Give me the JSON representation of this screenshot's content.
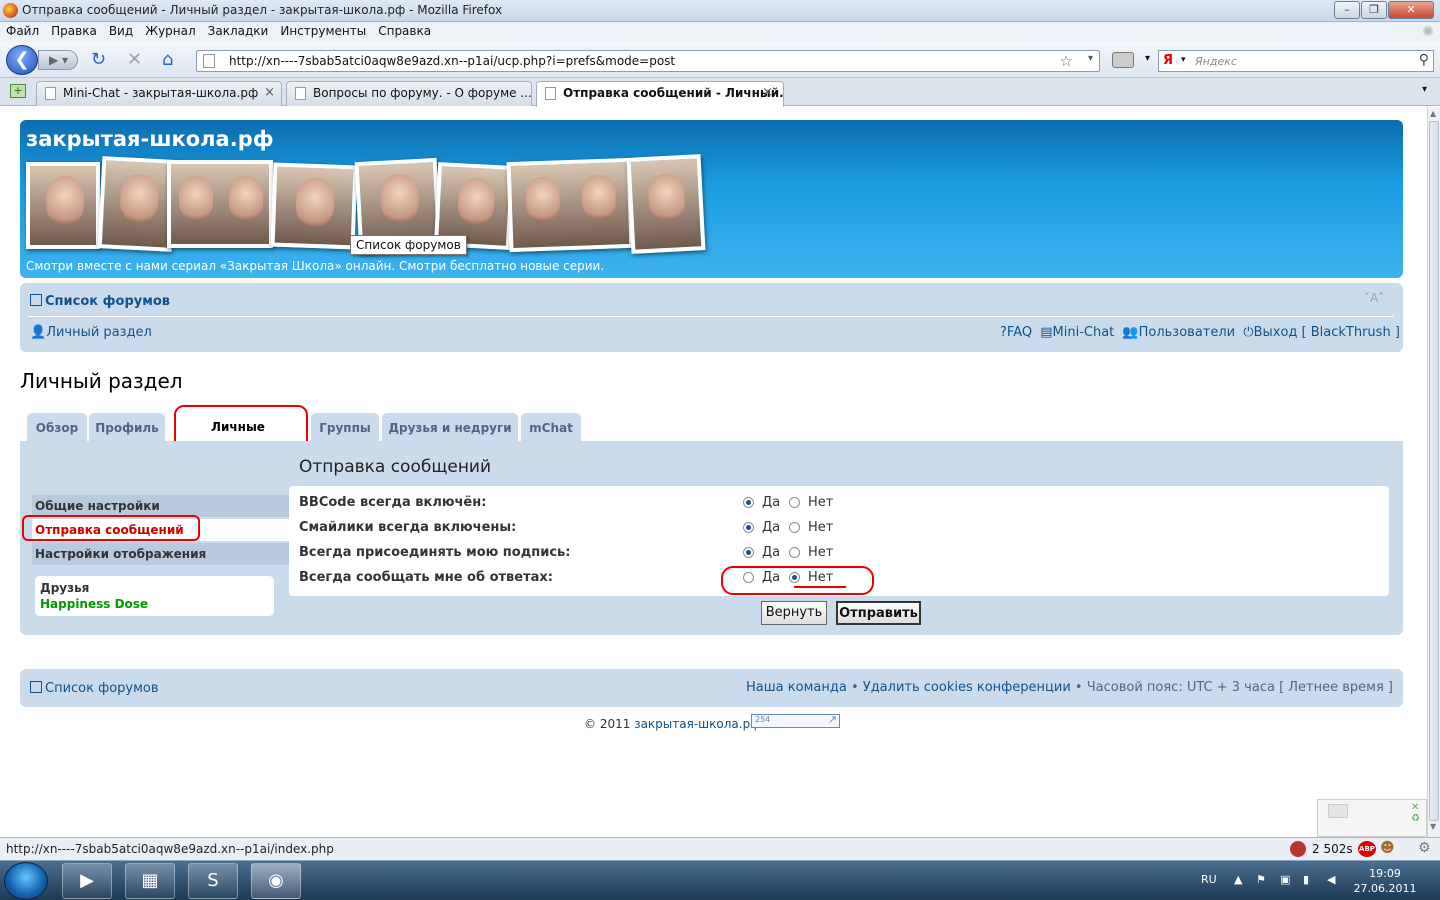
{
  "window": {
    "title": "Отправка сообщений - Личный раздел - закрытая-школа.рф - Mozilla Firefox"
  },
  "menu": [
    "Файл",
    "Правка",
    "Вид",
    "Журнал",
    "Закладки",
    "Инструменты",
    "Справка"
  ],
  "address": {
    "url": "http://xn----7sbab5atci0aqw8e9azd.xn--p1ai/ucp.php?i=prefs&mode=post"
  },
  "search": {
    "engine": "Я",
    "placeholder": "Яндекс"
  },
  "tabs": [
    {
      "label": "Mini-Chat - закрытая-школа.рф"
    },
    {
      "label": "Вопросы по форуму. - О форуме ..."
    },
    {
      "label": "Отправка сообщений - Личный..."
    }
  ],
  "site": {
    "name": "закрытая-школа.рф",
    "tagline": "Смотри вместе с нами сериал «Закрытая Школа» онлайн. Смотри бесплатно новые серии.",
    "tooltip": "Список форумов"
  },
  "nav": {
    "forum_index": "Список форумов",
    "ucp": "Личный раздел",
    "faq": "FAQ",
    "minichat": "Mini-Chat",
    "members": "Пользователи",
    "logout": "Выход [ BlackThrush ]",
    "resize": "˅A˄"
  },
  "page": {
    "title": "Личный раздел"
  },
  "ucp_tabs": [
    "Обзор",
    "Профиль",
    "Личные настройки",
    "Группы",
    "Друзья и недруги",
    "mChat"
  ],
  "sidebar": {
    "items": [
      "Общие настройки",
      "Отправка сообщений",
      "Настройки отображения"
    ],
    "friends_title": "Друзья",
    "friend_name": "Happiness Dose"
  },
  "form": {
    "heading": "Отправка сообщений",
    "rows": [
      {
        "label": "BBCode всегда включён:",
        "yes": "Да",
        "no": "Нет",
        "value": "yes"
      },
      {
        "label": "Смайлики всегда включены:",
        "yes": "Да",
        "no": "Нет",
        "value": "yes"
      },
      {
        "label": "Всегда присоединять мою подпись:",
        "yes": "Да",
        "no": "Нет",
        "value": "yes"
      },
      {
        "label": "Всегда сообщать мне об ответах:",
        "yes": "Да",
        "no": "Нет",
        "value": "no"
      }
    ],
    "reset": "Вернуть",
    "submit": "Отправить"
  },
  "footer": {
    "forum_index": "Список форумов",
    "team": "Наша команда",
    "sep": "•",
    "delete_cookies": "Удалить cookies конференции",
    "timezone": "Часовой пояс: UTC + 3 часа [ Летнее время ]",
    "copyright": "© 2011",
    "site": "закрытая-школа.рф",
    "counter": "254"
  },
  "status": {
    "url": "http://xn----7sbab5atci0aqw8e9azd.xn--p1ai/index.php",
    "extra": "2 502s"
  },
  "taskbar": {
    "lang": "RU",
    "time": "19:09",
    "date": "27.06.2011"
  },
  "colors": {
    "header": "#1a9be0",
    "panel": "#cadceb",
    "link": "#105289",
    "accent_red": "#cc0000",
    "green": "#009900"
  }
}
